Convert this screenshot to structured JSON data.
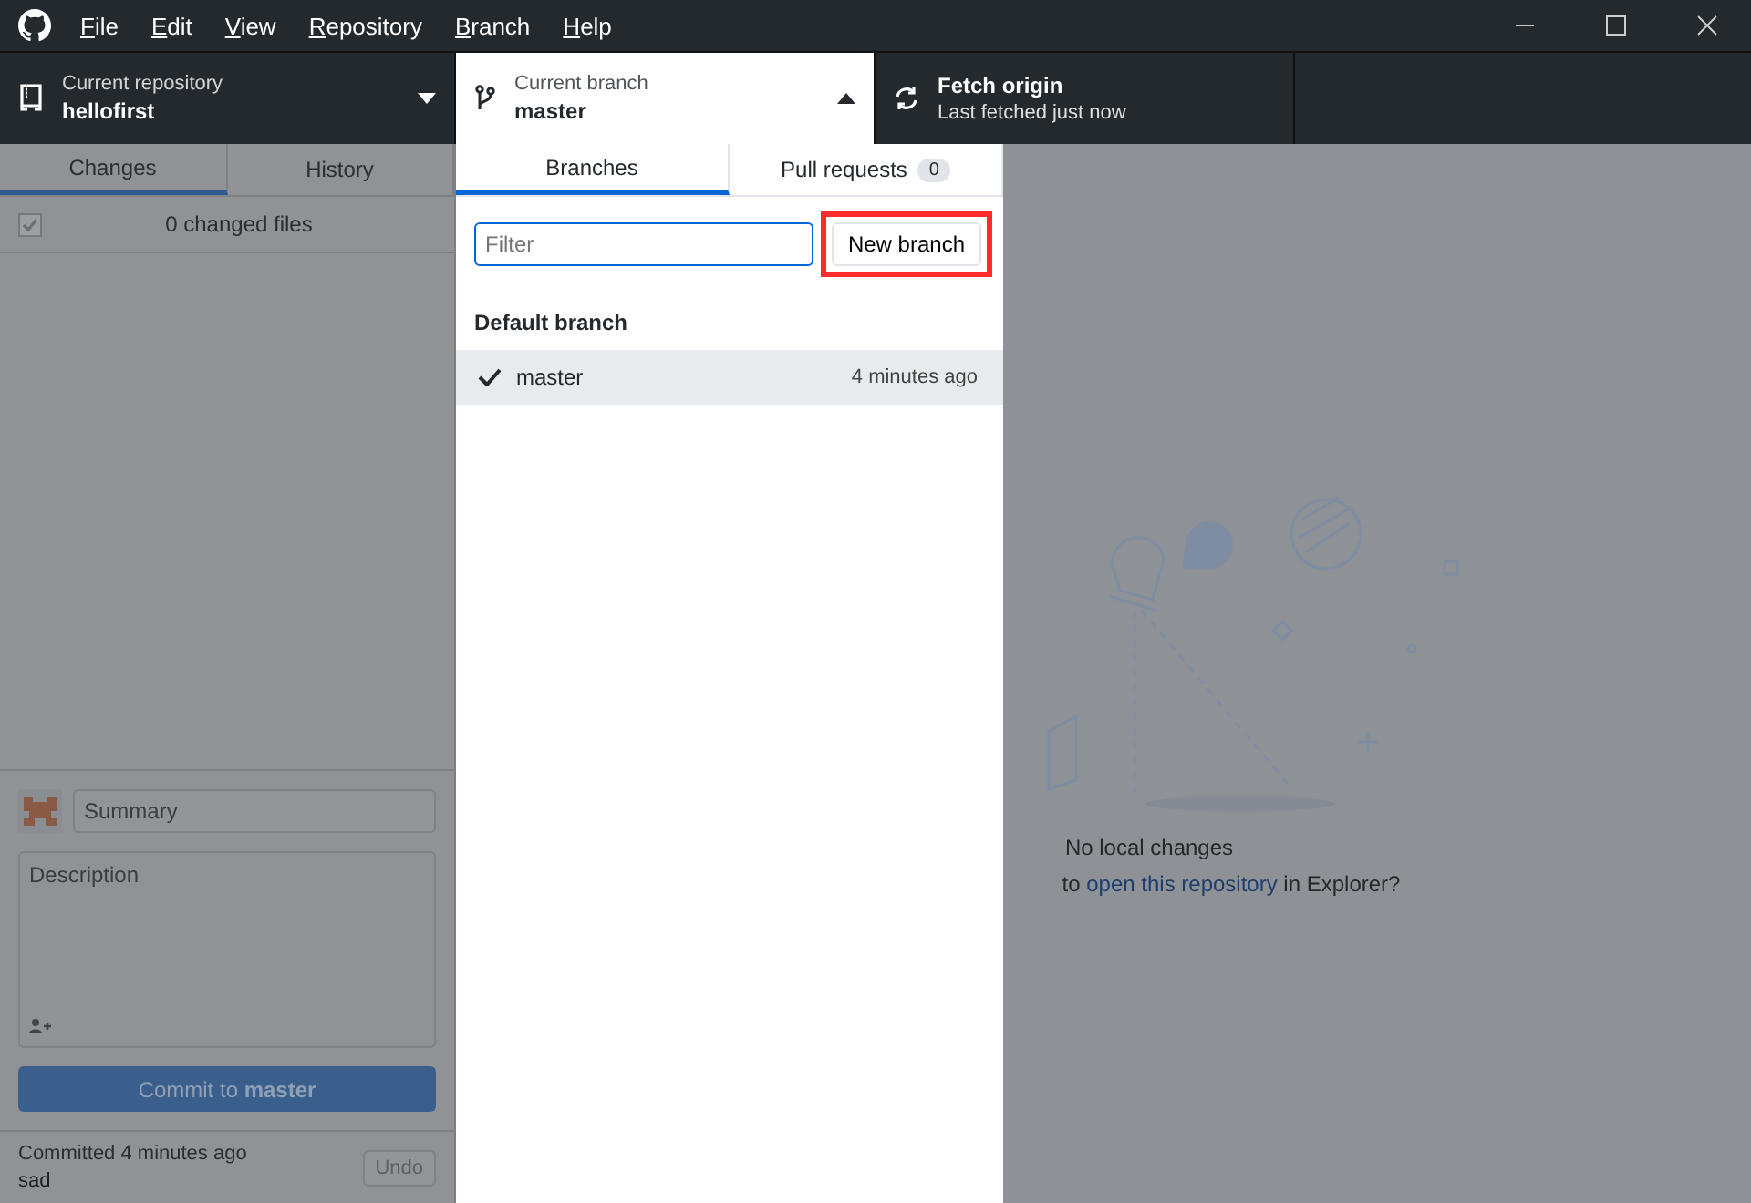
{
  "menu": [
    {
      "label": "File"
    },
    {
      "label": "Edit"
    },
    {
      "label": "View"
    },
    {
      "label": "Repository"
    },
    {
      "label": "Branch"
    },
    {
      "label": "Help"
    }
  ],
  "toolbar": {
    "repository": {
      "caption": "Current repository",
      "name": "hellofirst",
      "expanded": false
    },
    "branch": {
      "caption": "Current branch",
      "name": "master",
      "expanded": true
    },
    "fetch": {
      "title": "Fetch origin",
      "subtitle": "Last fetched just now"
    }
  },
  "sidebar": {
    "tabs": [
      {
        "label": "Changes",
        "selected": true
      },
      {
        "label": "History",
        "selected": false
      }
    ],
    "changes": {
      "checked": true,
      "label": "0 changed files"
    },
    "commit": {
      "summary_placeholder": "Summary",
      "description_placeholder": "Description",
      "button": "Commit to **master**",
      "disabled": true
    },
    "last_commit": {
      "caption": "Committed 4 minutes ago",
      "message": "sad",
      "undo": "Undo"
    }
  },
  "branch_menu": {
    "tabs": [
      {
        "label": "Branches",
        "selected": true
      },
      {
        "label": "Pull requests",
        "count": "0",
        "selected": false
      }
    ],
    "filter_placeholder": "Filter",
    "new_branch": "New branch",
    "highlighted": true,
    "groups": [
      {
        "heading": "Default branch",
        "branches": [
          {
            "name": "master",
            "time": "4 minutes ago",
            "current": true,
            "selected": true
          }
        ]
      }
    ]
  },
  "main": {
    "title": "No local changes",
    "hint_before": "to ",
    "link": "open this repository",
    "hint_after": " in Explorer?"
  }
}
